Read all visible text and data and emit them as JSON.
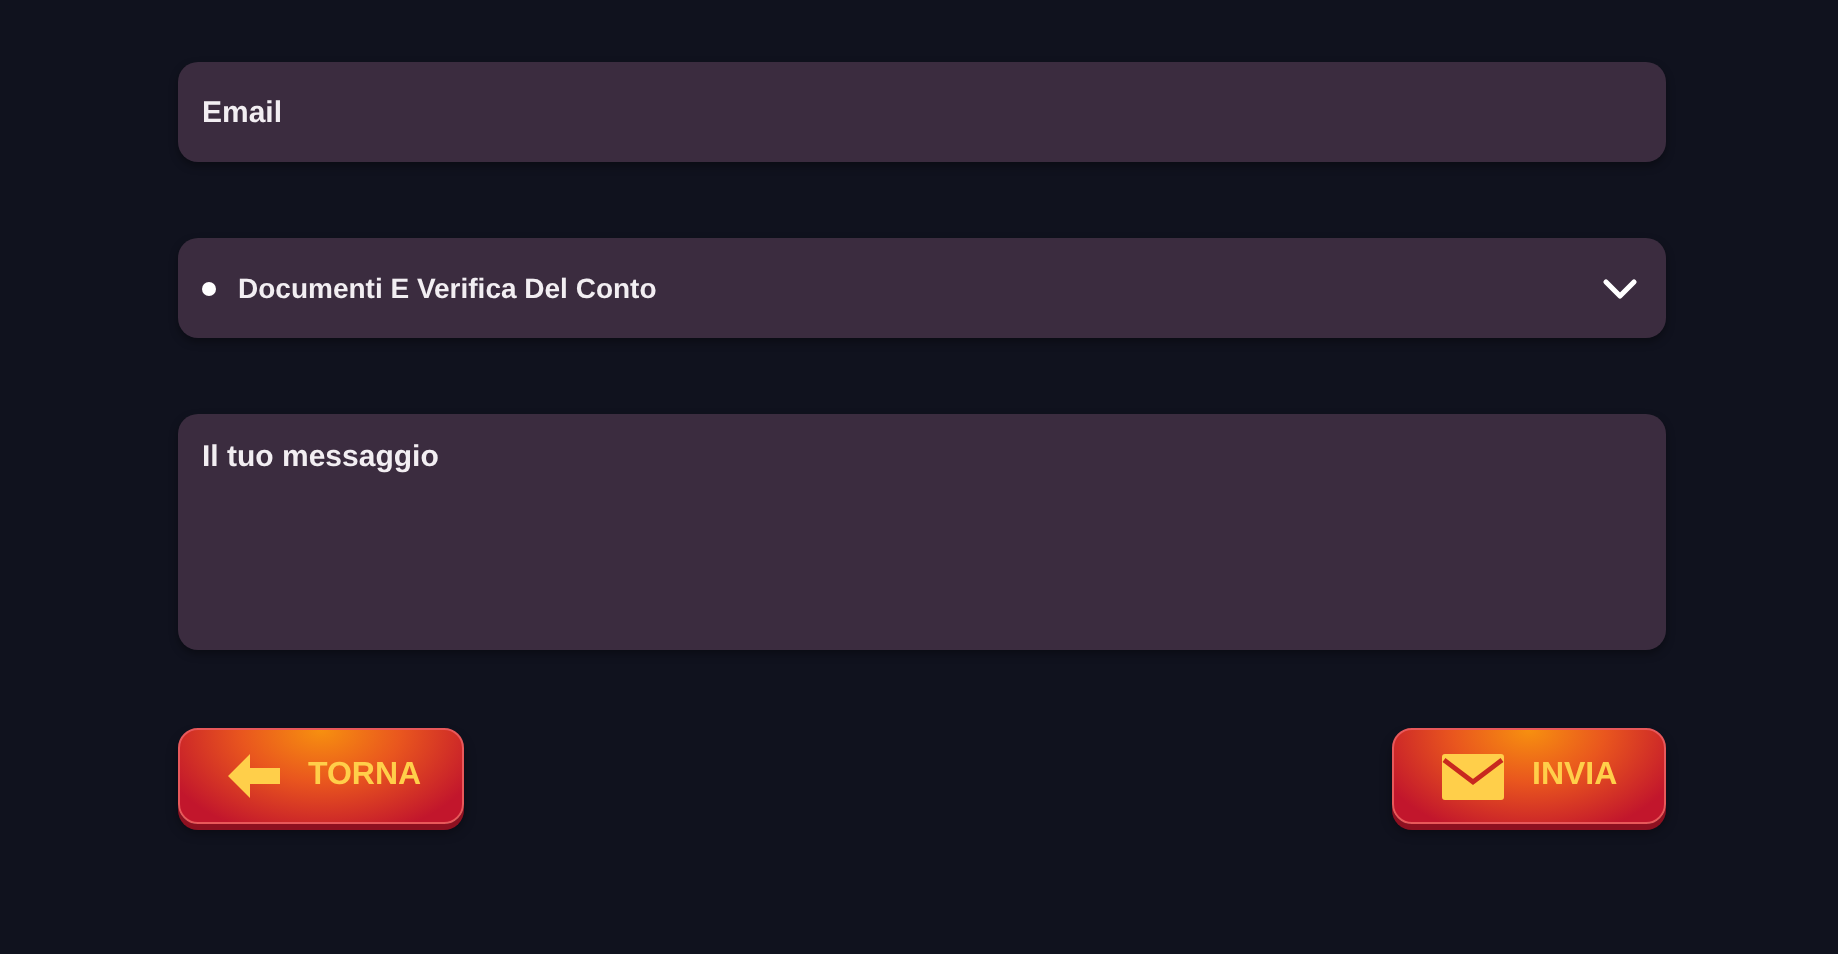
{
  "email": {
    "placeholder": "Email"
  },
  "topic": {
    "value": "Documenti E Verifica Del Conto"
  },
  "message": {
    "placeholder": "Il tuo messaggio"
  },
  "buttons": [
    {
      "label": "TORNA",
      "kind": "back"
    },
    {
      "label": "INVIA",
      "kind": "send"
    }
  ]
}
